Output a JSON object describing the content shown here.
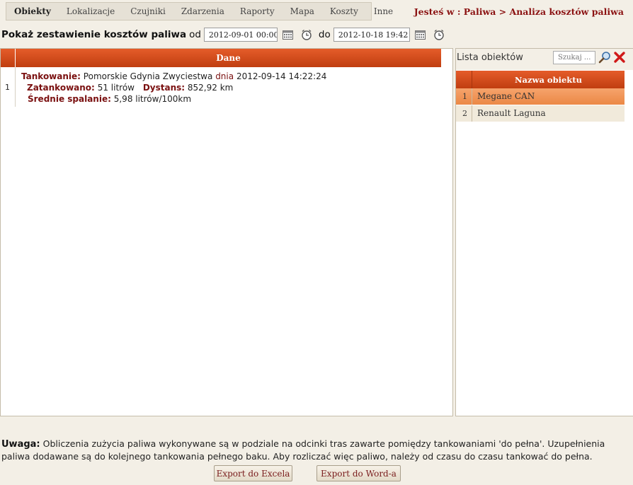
{
  "nav": {
    "items": [
      {
        "label": "Obiekty"
      },
      {
        "label": "Lokalizacje"
      },
      {
        "label": "Czujniki"
      },
      {
        "label": "Zdarzenia"
      },
      {
        "label": "Raporty"
      },
      {
        "label": "Mapa"
      },
      {
        "label": "Koszty"
      },
      {
        "label": "Inne"
      }
    ],
    "active_index": 0
  },
  "breadcrumb": "Jesteś w : Paliwa > Analiza kosztów paliwa",
  "filter": {
    "title": "Pokaż zestawienie kosztów paliwa",
    "from_label": "od",
    "from_value": "2012-09-01 00:00",
    "to_label": "do",
    "to_value": "2012-10-18 19:42"
  },
  "main": {
    "header": "Dane",
    "rows": [
      {
        "num": "1",
        "refuel_label": "Tankowanie:",
        "location": "Pomorskie Gdynia Zwyciestwa",
        "date_word": "dnia",
        "datetime": "2012-09-14 14:22:24",
        "fueled_label": "Zatankowano:",
        "fueled_value": "51 litrów",
        "distance_label": "Dystans:",
        "distance_value": "852,92 km",
        "avg_label": "Średnie spalanie:",
        "avg_value": "5,98 litrów/100km"
      }
    ]
  },
  "side": {
    "title": "Lista obiektów",
    "search_placeholder": "Szukaj ...",
    "column_header": "Nazwa obiektu",
    "objects": [
      {
        "num": "1",
        "name": "Megane CAN",
        "selected": true
      },
      {
        "num": "2",
        "name": "Renault Laguna",
        "selected": false
      }
    ]
  },
  "footer": {
    "note_label": "Uwaga:",
    "note_text": "Obliczenia zużycia paliwa wykonywane są w podziale na odcinki tras zawarte pomiędzy tankowaniami 'do pełna'. Uzupełnienia paliwa dodawane są do kolejnego tankowania pełnego baku. Aby rozliczać więc paliwo, należy od czasu do czasu tankować do pełna.",
    "export_excel": "Export do Excela",
    "export_word": "Export do Word-a"
  },
  "colors": {
    "accent_header": "#d24a1a",
    "selected_row": "#f09050",
    "label_dark_red": "#7a1010",
    "breadcrumb": "#8b1212",
    "background": "#f3efe6"
  }
}
